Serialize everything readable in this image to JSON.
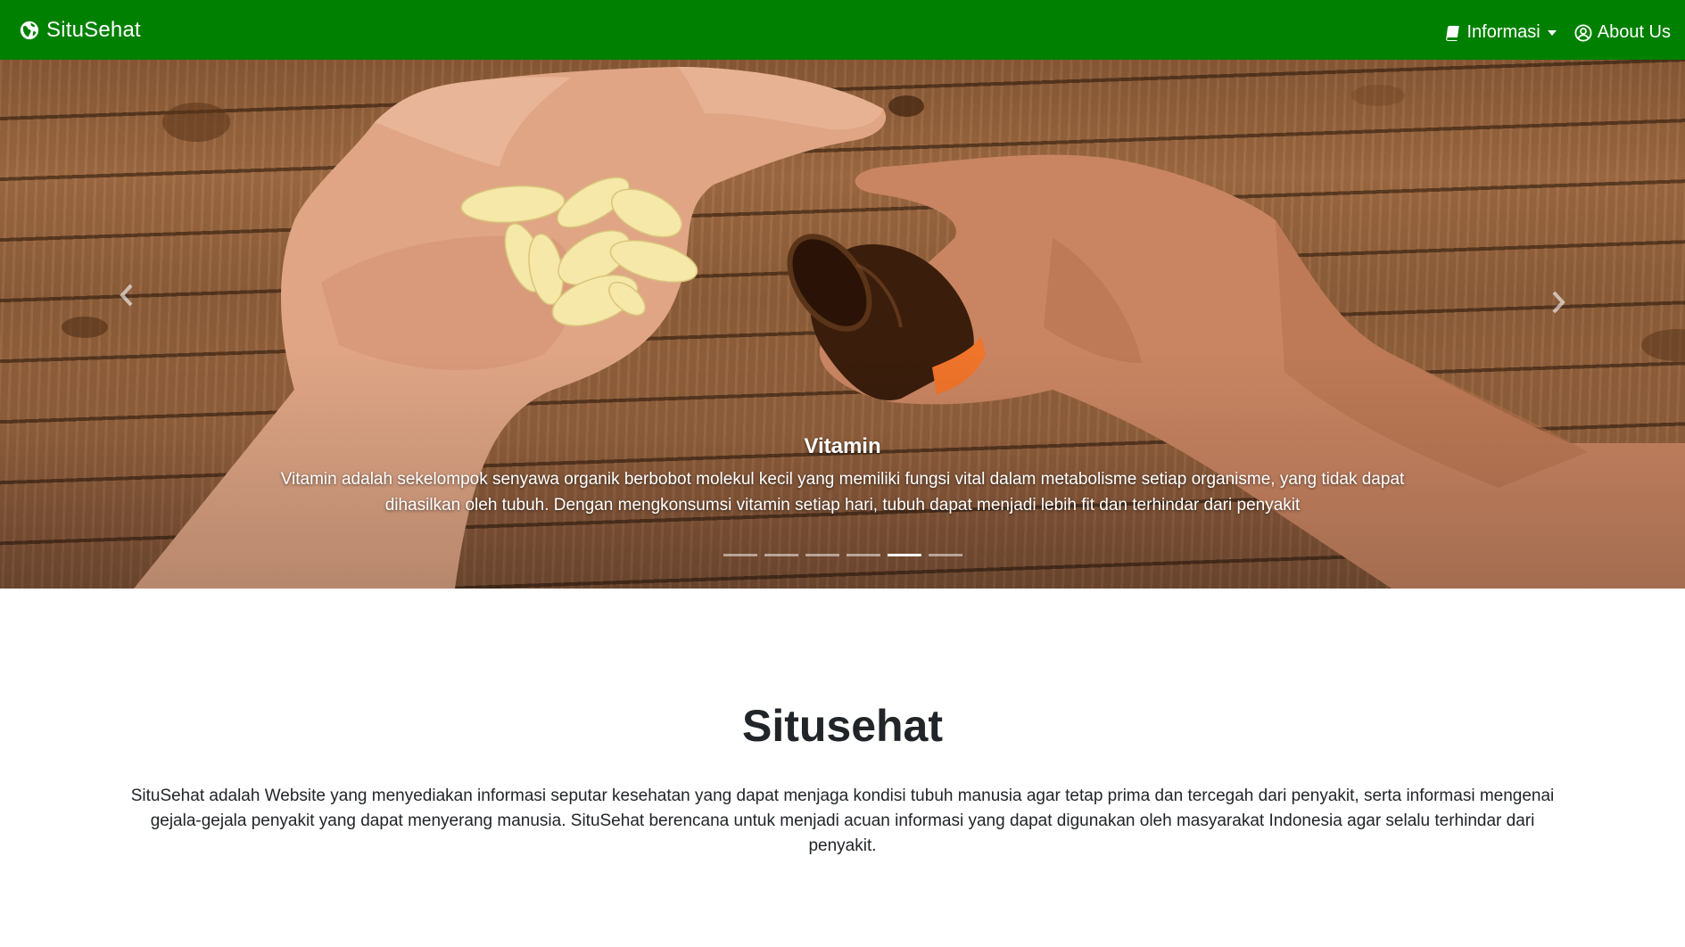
{
  "navbar": {
    "brand": "SituSehat",
    "brand_icon": "globe-icon",
    "items": [
      {
        "label": "Informasi",
        "icon": "book-icon",
        "has_dropdown": true
      },
      {
        "label": "About Us",
        "icon": "user-circle-icon",
        "has_dropdown": false
      }
    ],
    "background_color": "#008000"
  },
  "carousel": {
    "caption": {
      "title": "Vitamin",
      "text": "Vitamin adalah sekelompok senyawa organik berbobot molekul kecil yang memiliki fungsi vital dalam metabolisme setiap organisme, yang tidak dapat dihasilkan oleh tubuh. Dengan mengkonsumsi vitamin setiap hari, tubuh dapat menjadi lebih fit dan terhindar dari penyakit"
    },
    "indicators": {
      "count": 6,
      "active": 5
    },
    "controls": {
      "prev_icon": "chevron-left-icon",
      "next_icon": "chevron-right-icon"
    }
  },
  "main": {
    "title": "Situsehat",
    "description": "SituSehat adalah Website yang menyediakan informasi seputar kesehatan yang dapat menjaga kondisi tubuh manusia agar tetap prima dan tercegah dari penyakit, serta informasi mengenai gejala-gejala penyakit yang dapat menyerang manusia. SituSehat berencana untuk menjadi acuan informasi yang dapat digunakan oleh masyarakat Indonesia agar selalu terhindar dari penyakit."
  }
}
